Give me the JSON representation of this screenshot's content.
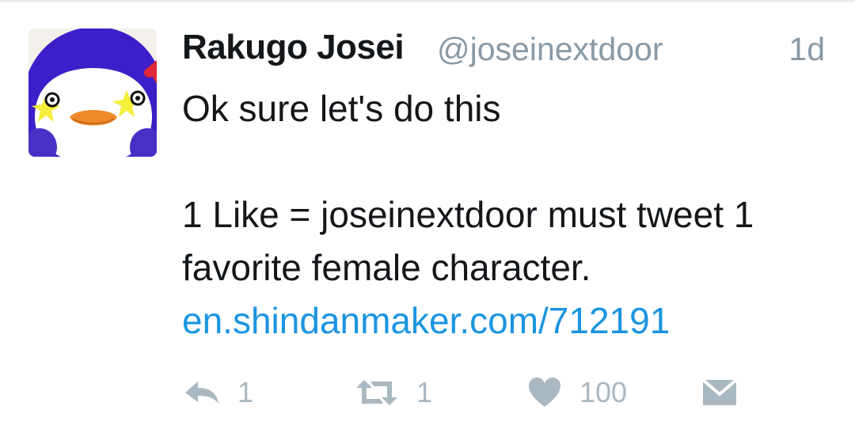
{
  "tweet": {
    "display_name": "Rakugo Josei",
    "handle": "@joseinextdoor",
    "timestamp": "1d",
    "text_line_1": "Ok sure let's do this",
    "text_line_2": "1 Like = joseinextdoor must tweet 1",
    "text_line_3": "favorite female character.",
    "link": "en.shindanmaker.com/712191"
  },
  "actions": {
    "reply_count": "1",
    "retweet_count": "1",
    "like_count": "100"
  },
  "colors": {
    "text": "#14171a",
    "secondary": "#8899a6",
    "link": "#1b95e0",
    "icon": "#aab8c2"
  },
  "icons": {
    "reply": "reply-icon",
    "retweet": "retweet-icon",
    "like": "heart-icon",
    "message": "envelope-icon"
  }
}
